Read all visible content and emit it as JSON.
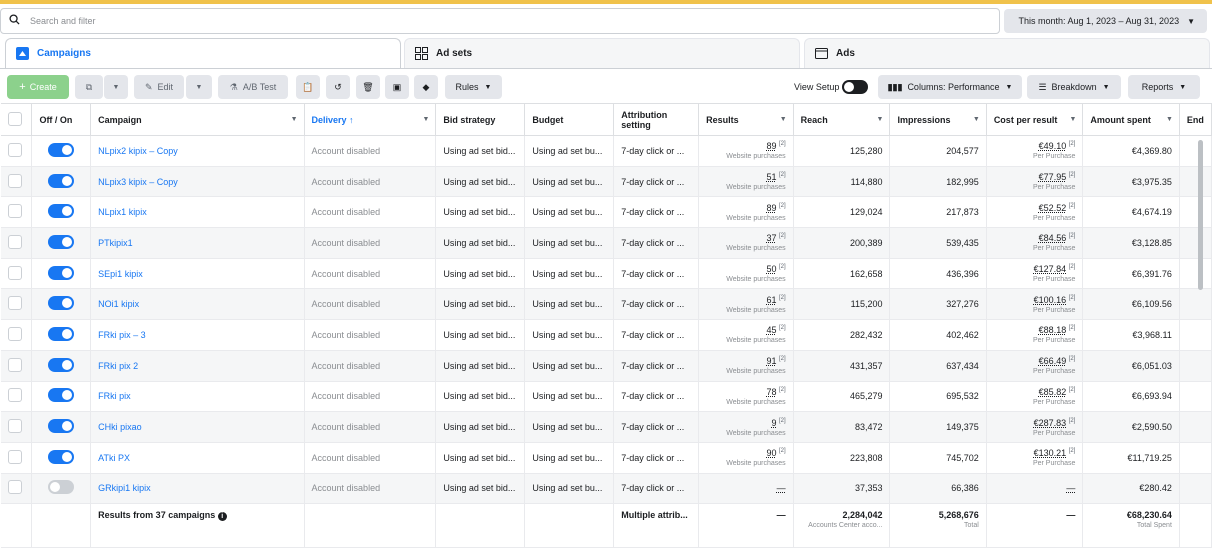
{
  "search": {
    "placeholder": "Search and filter"
  },
  "date_range": "This month: Aug 1, 2023 – Aug 31, 2023",
  "tabs": [
    {
      "label": "Campaigns"
    },
    {
      "label": "Ad sets"
    },
    {
      "label": "Ads"
    }
  ],
  "toolbar": {
    "create": "Create",
    "edit": "Edit",
    "ab_test": "A/B Test",
    "rules": "Rules",
    "view_setup": "View Setup",
    "columns": "Columns: Performance",
    "breakdown": "Breakdown",
    "reports": "Reports"
  },
  "columns": {
    "off_on": "Off / On",
    "campaign": "Campaign",
    "delivery": "Delivery ↑",
    "bid_strategy": "Bid strategy",
    "budget": "Budget",
    "attribution": "Attribution setting",
    "results": "Results",
    "reach": "Reach",
    "impressions": "Impressions",
    "cost_per_result": "Cost per result",
    "amount_spent": "Amount spent",
    "ends": "End"
  },
  "rows": [
    {
      "on": true,
      "name": "NLpix2 kipix – Copy",
      "delivery": "Account disabled",
      "bid": "Using ad set bid...",
      "budget": "Using ad set bu...",
      "attr": "7-day click or ...",
      "results": "89",
      "results_sub": "Website purchases",
      "reach": "125,280",
      "impressions": "204,577",
      "cpr": "€49.10",
      "cpr_sub": "Per Purchase",
      "spent": "€4,369.80"
    },
    {
      "on": true,
      "name": "NLpix3 kipix – Copy",
      "delivery": "Account disabled",
      "bid": "Using ad set bid...",
      "budget": "Using ad set bu...",
      "attr": "7-day click or ...",
      "results": "51",
      "results_sub": "Website purchases",
      "reach": "114,880",
      "impressions": "182,995",
      "cpr": "€77.95",
      "cpr_sub": "Per Purchase",
      "spent": "€3,975.35"
    },
    {
      "on": true,
      "name": "NLpix1 kipix",
      "delivery": "Account disabled",
      "bid": "Using ad set bid...",
      "budget": "Using ad set bu...",
      "attr": "7-day click or ...",
      "results": "89",
      "results_sub": "Website purchases",
      "reach": "129,024",
      "impressions": "217,873",
      "cpr": "€52.52",
      "cpr_sub": "Per Purchase",
      "spent": "€4,674.19"
    },
    {
      "on": true,
      "name": "PTkipix1",
      "delivery": "Account disabled",
      "bid": "Using ad set bid...",
      "budget": "Using ad set bu...",
      "attr": "7-day click or ...",
      "results": "37",
      "results_sub": "Website purchases",
      "reach": "200,389",
      "impressions": "539,435",
      "cpr": "€84.56",
      "cpr_sub": "Per Purchase",
      "spent": "€3,128.85"
    },
    {
      "on": true,
      "name": "SEpi1 kipix",
      "delivery": "Account disabled",
      "bid": "Using ad set bid...",
      "budget": "Using ad set bu...",
      "attr": "7-day click or ...",
      "results": "50",
      "results_sub": "Website purchases",
      "reach": "162,658",
      "impressions": "436,396",
      "cpr": "€127.84",
      "cpr_sub": "Per Purchase",
      "spent": "€6,391.76"
    },
    {
      "on": true,
      "name": "NOi1 kipix",
      "delivery": "Account disabled",
      "bid": "Using ad set bid...",
      "budget": "Using ad set bu...",
      "attr": "7-day click or ...",
      "results": "61",
      "results_sub": "Website purchases",
      "reach": "115,200",
      "impressions": "327,276",
      "cpr": "€100.16",
      "cpr_sub": "Per Purchase",
      "spent": "€6,109.56"
    },
    {
      "on": true,
      "name": "FRki pix – 3",
      "delivery": "Account disabled",
      "bid": "Using ad set bid...",
      "budget": "Using ad set bu...",
      "attr": "7-day click or ...",
      "results": "45",
      "results_sub": "Website purchases",
      "reach": "282,432",
      "impressions": "402,462",
      "cpr": "€88.18",
      "cpr_sub": "Per Purchase",
      "spent": "€3,968.11"
    },
    {
      "on": true,
      "name": "FRki pix 2",
      "delivery": "Account disabled",
      "bid": "Using ad set bid...",
      "budget": "Using ad set bu...",
      "attr": "7-day click or ...",
      "results": "91",
      "results_sub": "Website purchases",
      "reach": "431,357",
      "impressions": "637,434",
      "cpr": "€66.49",
      "cpr_sub": "Per Purchase",
      "spent": "€6,051.03"
    },
    {
      "on": true,
      "name": "FRki pix",
      "delivery": "Account disabled",
      "bid": "Using ad set bid...",
      "budget": "Using ad set bu...",
      "attr": "7-day click or ...",
      "results": "78",
      "results_sub": "Website purchases",
      "reach": "465,279",
      "impressions": "695,532",
      "cpr": "€85.82",
      "cpr_sub": "Per Purchase",
      "spent": "€6,693.94"
    },
    {
      "on": true,
      "name": "CHki pixao",
      "delivery": "Account disabled",
      "bid": "Using ad set bid...",
      "budget": "Using ad set bu...",
      "attr": "7-day click or ...",
      "results": "9",
      "results_sub": "Website purchases",
      "reach": "83,472",
      "impressions": "149,375",
      "cpr": "€287.83",
      "cpr_sub": "Per Purchase",
      "spent": "€2,590.50"
    },
    {
      "on": true,
      "name": "ATki PX",
      "delivery": "Account disabled",
      "bid": "Using ad set bid...",
      "budget": "Using ad set bu...",
      "attr": "7-day click or ...",
      "results": "90",
      "results_sub": "Website purchases",
      "reach": "223,808",
      "impressions": "745,702",
      "cpr": "€130.21",
      "cpr_sub": "Per Purchase",
      "spent": "€11,719.25"
    },
    {
      "on": false,
      "name": "GRkipi1 kipix",
      "delivery": "Account disabled",
      "bid": "Using ad set bid...",
      "budget": "Using ad set bu...",
      "attr": "7-day click or ...",
      "results": "—",
      "results_sub": "",
      "reach": "37,353",
      "impressions": "66,386",
      "cpr": "—",
      "cpr_sub": "",
      "spent": "€280.42"
    }
  ],
  "summary": {
    "label": "Results from 37 campaigns",
    "attr": "Multiple attrib...",
    "results": "—",
    "reach": "2,284,042",
    "reach_sub": "Accounts Center acco...",
    "impressions": "5,268,676",
    "impressions_sub": "Total",
    "cpr": "—",
    "spent": "€68,230.64",
    "spent_sub": "Total Spent"
  }
}
